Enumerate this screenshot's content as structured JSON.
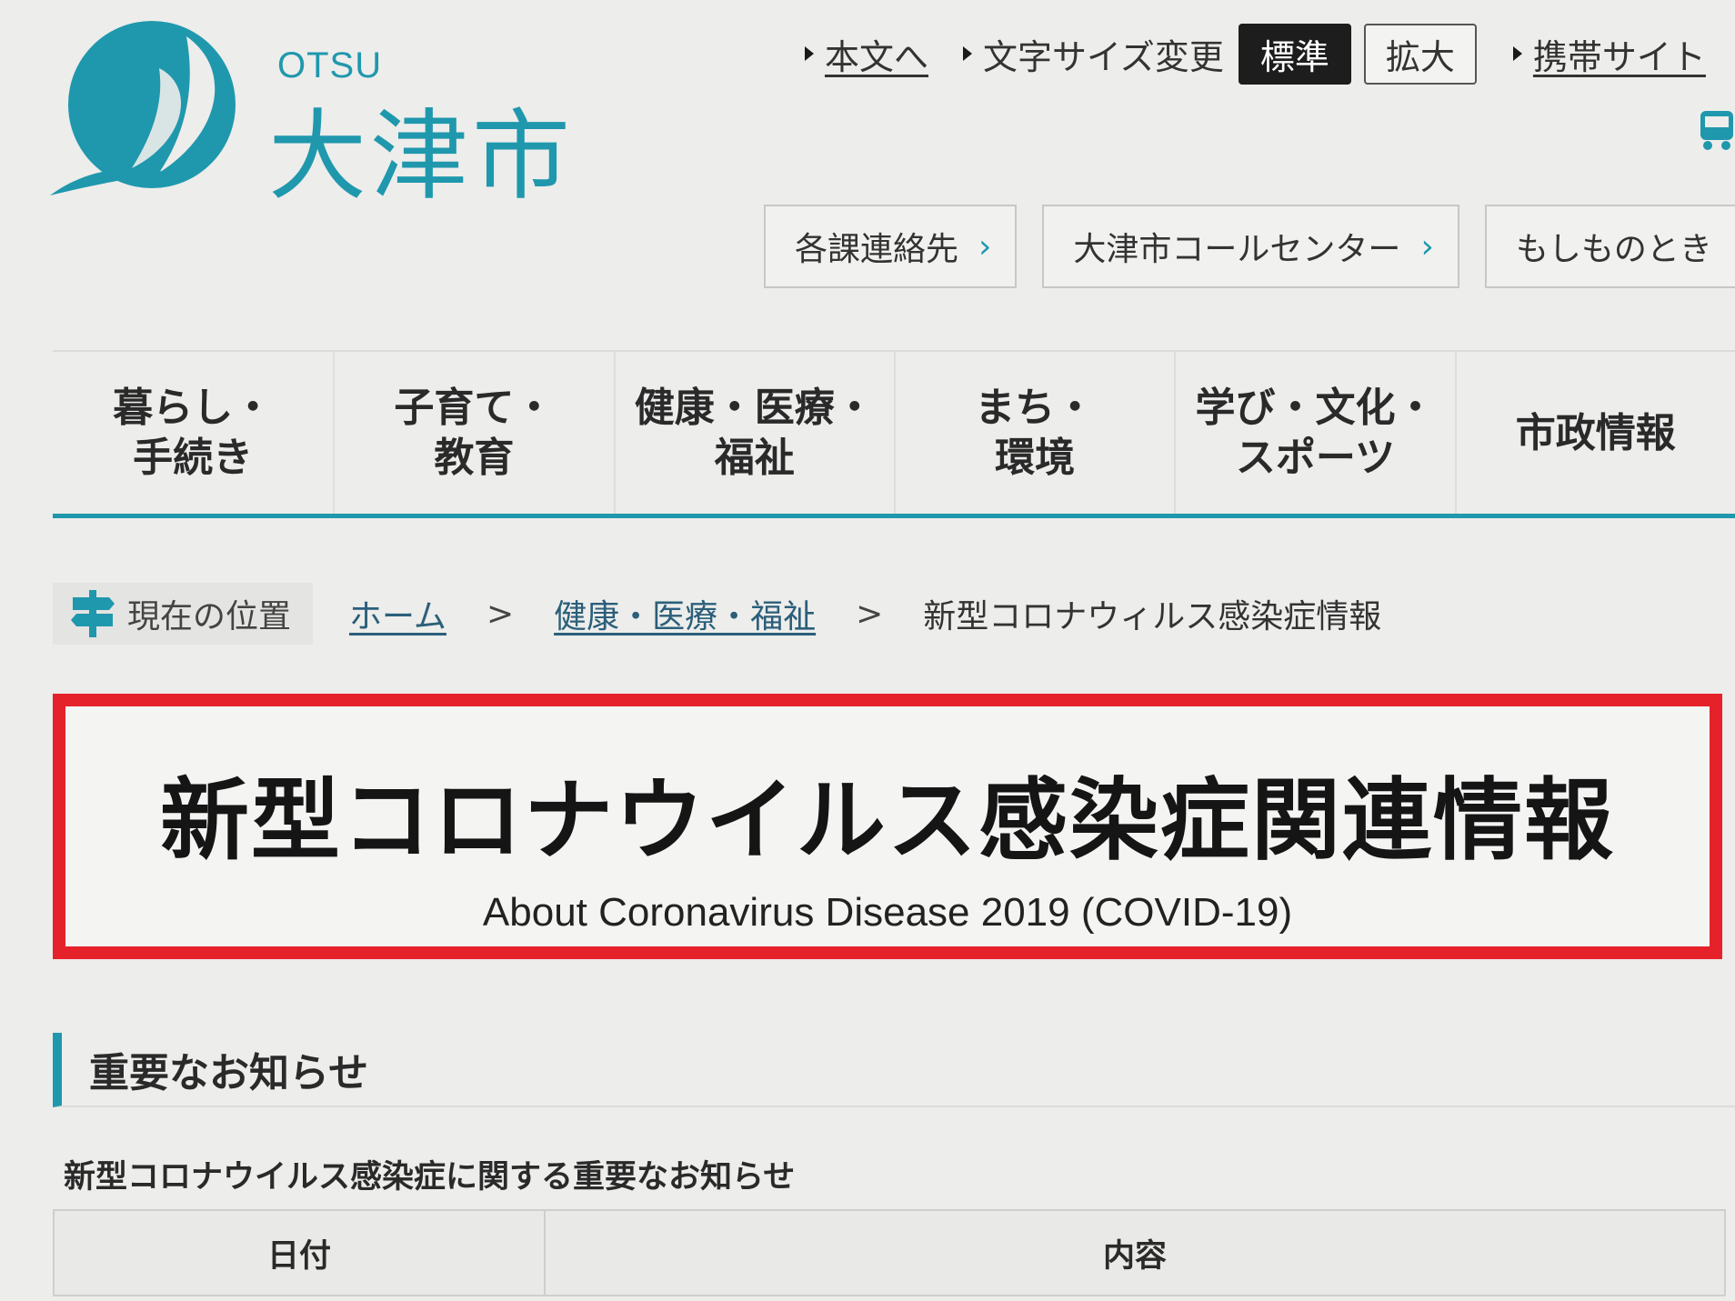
{
  "logo": {
    "roman": "OTSU",
    "kanji": "大津市",
    "brand_color": "#1f98ad"
  },
  "utility": {
    "skip_link": "本文へ",
    "text_size_label": "文字サイズ変更",
    "size_standard": "標準",
    "size_large": "拡大",
    "mobile_link": "携帯サイト",
    "car_icon": "bus-icon"
  },
  "quick_links": [
    {
      "label": "各課連絡先"
    },
    {
      "label": "大津市コールセンター"
    },
    {
      "label": "もしものとき"
    }
  ],
  "gnav": [
    {
      "label": "暮らし・\n手続き"
    },
    {
      "label": "子育て・\n教育"
    },
    {
      "label": "健康・医療・\n福祉"
    },
    {
      "label": "まち・\n環境"
    },
    {
      "label": "学び・文化・\nスポーツ"
    },
    {
      "label": "市政情報"
    }
  ],
  "breadcrumb": {
    "label": "現在の位置",
    "home": "ホーム",
    "sep": ">",
    "parent": "健康・医療・福祉",
    "current": "新型コロナウィルス感染症情報"
  },
  "banner": {
    "title": "新型コロナウイルス感染症関連情報",
    "subtitle": "About Coronavirus Disease 2019 (COVID-19)",
    "border_color": "#e5222a"
  },
  "notices": {
    "heading": "重要なお知らせ",
    "subheading": "新型コロナウイルス感染症に関する重要なお知らせ",
    "columns": [
      "日付",
      "内容"
    ]
  }
}
